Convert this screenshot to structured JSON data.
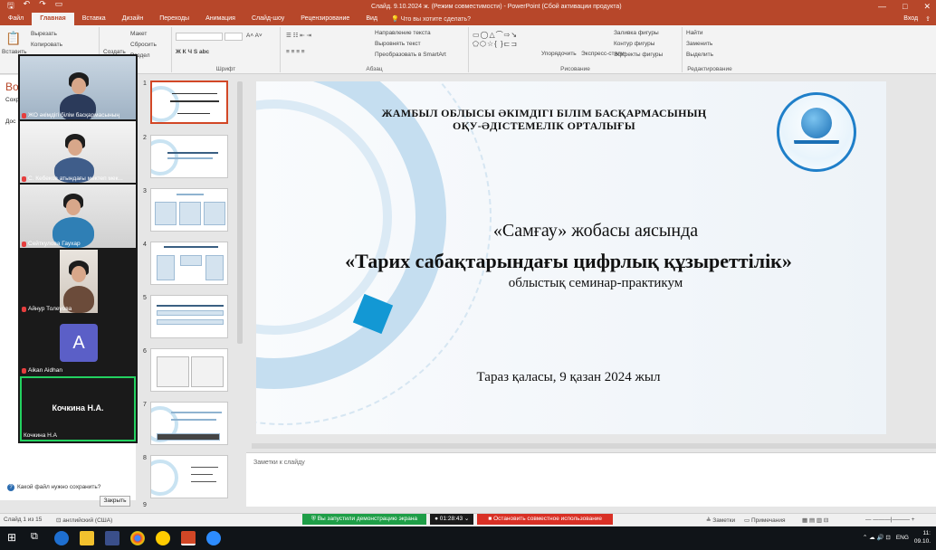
{
  "window": {
    "title": "Слайд. 9.10.2024 ж. (Режим совместимости) - PowerPoint (Сбой активации продукта)",
    "login": "Вход",
    "controls": [
      "—",
      "□",
      "✕"
    ]
  },
  "ribbon_tabs": [
    "Файл",
    "Главная",
    "Вставка",
    "Дизайн",
    "Переходы",
    "Анимация",
    "Слайд-шоу",
    "Рецензирование",
    "Вид"
  ],
  "tell_me": "Что вы хотите сделать?",
  "ribbon": {
    "clipboard": {
      "paste": "Вставить",
      "cut": "Вырезать",
      "copy": "Копировать",
      "format": "Формат"
    },
    "slides": {
      "create": "Создать",
      "layout": "Макет",
      "reset": "Сбросить",
      "section": "Раздел"
    },
    "font_label": "Шрифт",
    "paragraph": {
      "label": "Абзац",
      "direction": "Направление текста",
      "align": "Выровнять текст",
      "smartart": "Преобразовать в SmartArt"
    },
    "drawing": {
      "label": "Рисование",
      "arrange": "Упорядочить",
      "styles": "Экспресс-стили",
      "fill": "Заливка фигуры",
      "outline": "Контур фигуры",
      "effects": "Эффекты фигуры"
    },
    "editing": {
      "label": "Редактирование",
      "find": "Найти",
      "replace": "Заменить",
      "select": "Выделить"
    }
  },
  "left_panel": {
    "title_fragment": "Во",
    "side_fragments": [
      "Сохр",
      "Дос"
    ],
    "help_question": "Какой файл нужно сохранить?",
    "close_button": "Закрыть"
  },
  "participants": [
    {
      "name": "ЖО әкімдігі білім басқармасының",
      "type": "video"
    },
    {
      "name": "С. Кебеков атындағы мектеп мек...",
      "type": "video"
    },
    {
      "name": "Сейткулова Гаухар",
      "type": "video"
    },
    {
      "name": "Айнур Толеуова",
      "type": "video"
    },
    {
      "name": "Aikan Aidhan",
      "type": "avatar",
      "initial": "A"
    },
    {
      "name": "Кочкина Н.А",
      "type": "name",
      "display": "Кочкина Н.А."
    }
  ],
  "thumbnails": [
    1,
    2,
    3,
    4,
    5,
    6,
    7,
    8,
    9
  ],
  "slide": {
    "org_line1": "ЖАМБЫЛ ОБЛЫСЫ ӘКІМДІГІ БІЛІМ БАСҚАРМАСЫНЫҢ",
    "org_line2": "ОҚУ-ӘДІСТЕМЕЛІК ОРТАЛЫҒЫ",
    "line1": "«Самғау» жобасы аясында",
    "line2": "«Тарих сабақтарындағы цифрлық құзыреттілік»",
    "line3": "облыстық семинар-практикум",
    "footer": "Тараз қаласы, 9 қазан 2024 жыл"
  },
  "notes_placeholder": "Заметки к слайду",
  "status": {
    "slide_count": "Слайд 1 из 15",
    "language": "английский (США)",
    "notes": "Заметки",
    "comments": "Примечания",
    "sharing": "Вы запустили демонстрацию экрана",
    "timer": "01:28:43",
    "stop_sharing": "Остановить совместное использование"
  },
  "taskbar": {
    "lang": "ENG",
    "time": "11:",
    "date": "09.10."
  },
  "colors": {
    "accent": "#b7472a",
    "selection": "#d24726",
    "share_green": "#1e9e47",
    "share_red": "#d93025"
  }
}
